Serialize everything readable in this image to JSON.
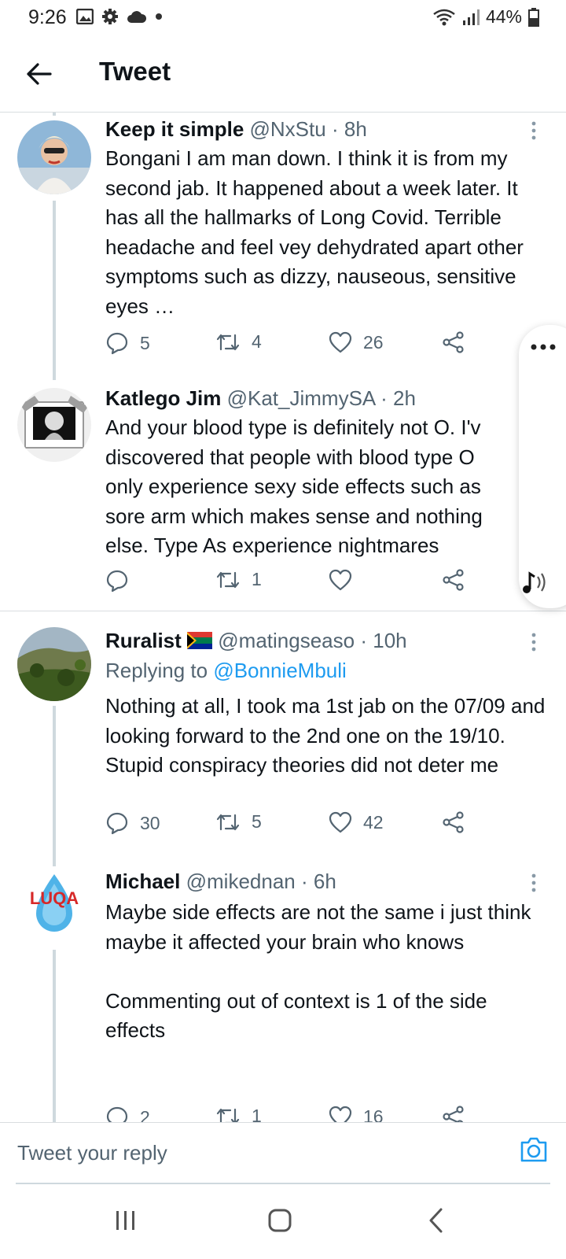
{
  "status_bar": {
    "time": "9:26",
    "battery": "44%"
  },
  "header": {
    "title": "Tweet"
  },
  "tweets": [
    {
      "name": "Keep it simple",
      "handle": "@NxStu",
      "dot": "·",
      "time": "8h",
      "body": "Bongani I am man down. I think it is from my second jab. It happened about a week later. It has all the hallmarks of Long Covid. Terrible headache and feel vey dehydrated apart other symptoms such as dizzy, nauseous, sensitive eyes …",
      "replies": "5",
      "retweets": "4",
      "likes": "26"
    },
    {
      "name": "Katlego Jim",
      "handle": "@Kat_JimmySA",
      "dot": "·",
      "time": "2h",
      "body": "And your blood type is definitely not O. I'v discovered that people with blood type O only experience sexy side effects such as sore arm which makes sense and nothing else. Type As experience nightmares",
      "replies": "",
      "retweets": "1",
      "likes": ""
    },
    {
      "name": "Ruralist",
      "flag": "🇿🇦",
      "handle": "@matingseaso",
      "dot": "·",
      "time": "10h",
      "replying_prefix": "Replying to ",
      "replying_to": "@BonnieMbuli",
      "body": "Nothing at all, I took ma 1st jab on the 07/09 and looking forward to the 2nd one on the 19/10.  Stupid conspiracy theories did not deter me",
      "replies": "30",
      "retweets": "5",
      "likes": "42"
    },
    {
      "name": "Michael",
      "handle": "@mikednan",
      "dot": "·",
      "time": "6h",
      "avatar_text": "LUQA",
      "body": "Maybe side effects are not the same i just think maybe it affected your brain who knows\n\nCommenting out of context is 1 of the side effects",
      "replies": "2",
      "retweets": "1",
      "likes": "16"
    }
  ],
  "reply_bar": {
    "placeholder": "Tweet your reply"
  },
  "colors": {
    "accent": "#1d9bf0",
    "secondary_text": "#536471",
    "thread_line": "#cfd9de"
  },
  "icons": [
    "back-arrow-icon",
    "reply-icon",
    "retweet-icon",
    "like-icon",
    "share-icon",
    "more-icon",
    "camera-icon",
    "audio-icon"
  ]
}
